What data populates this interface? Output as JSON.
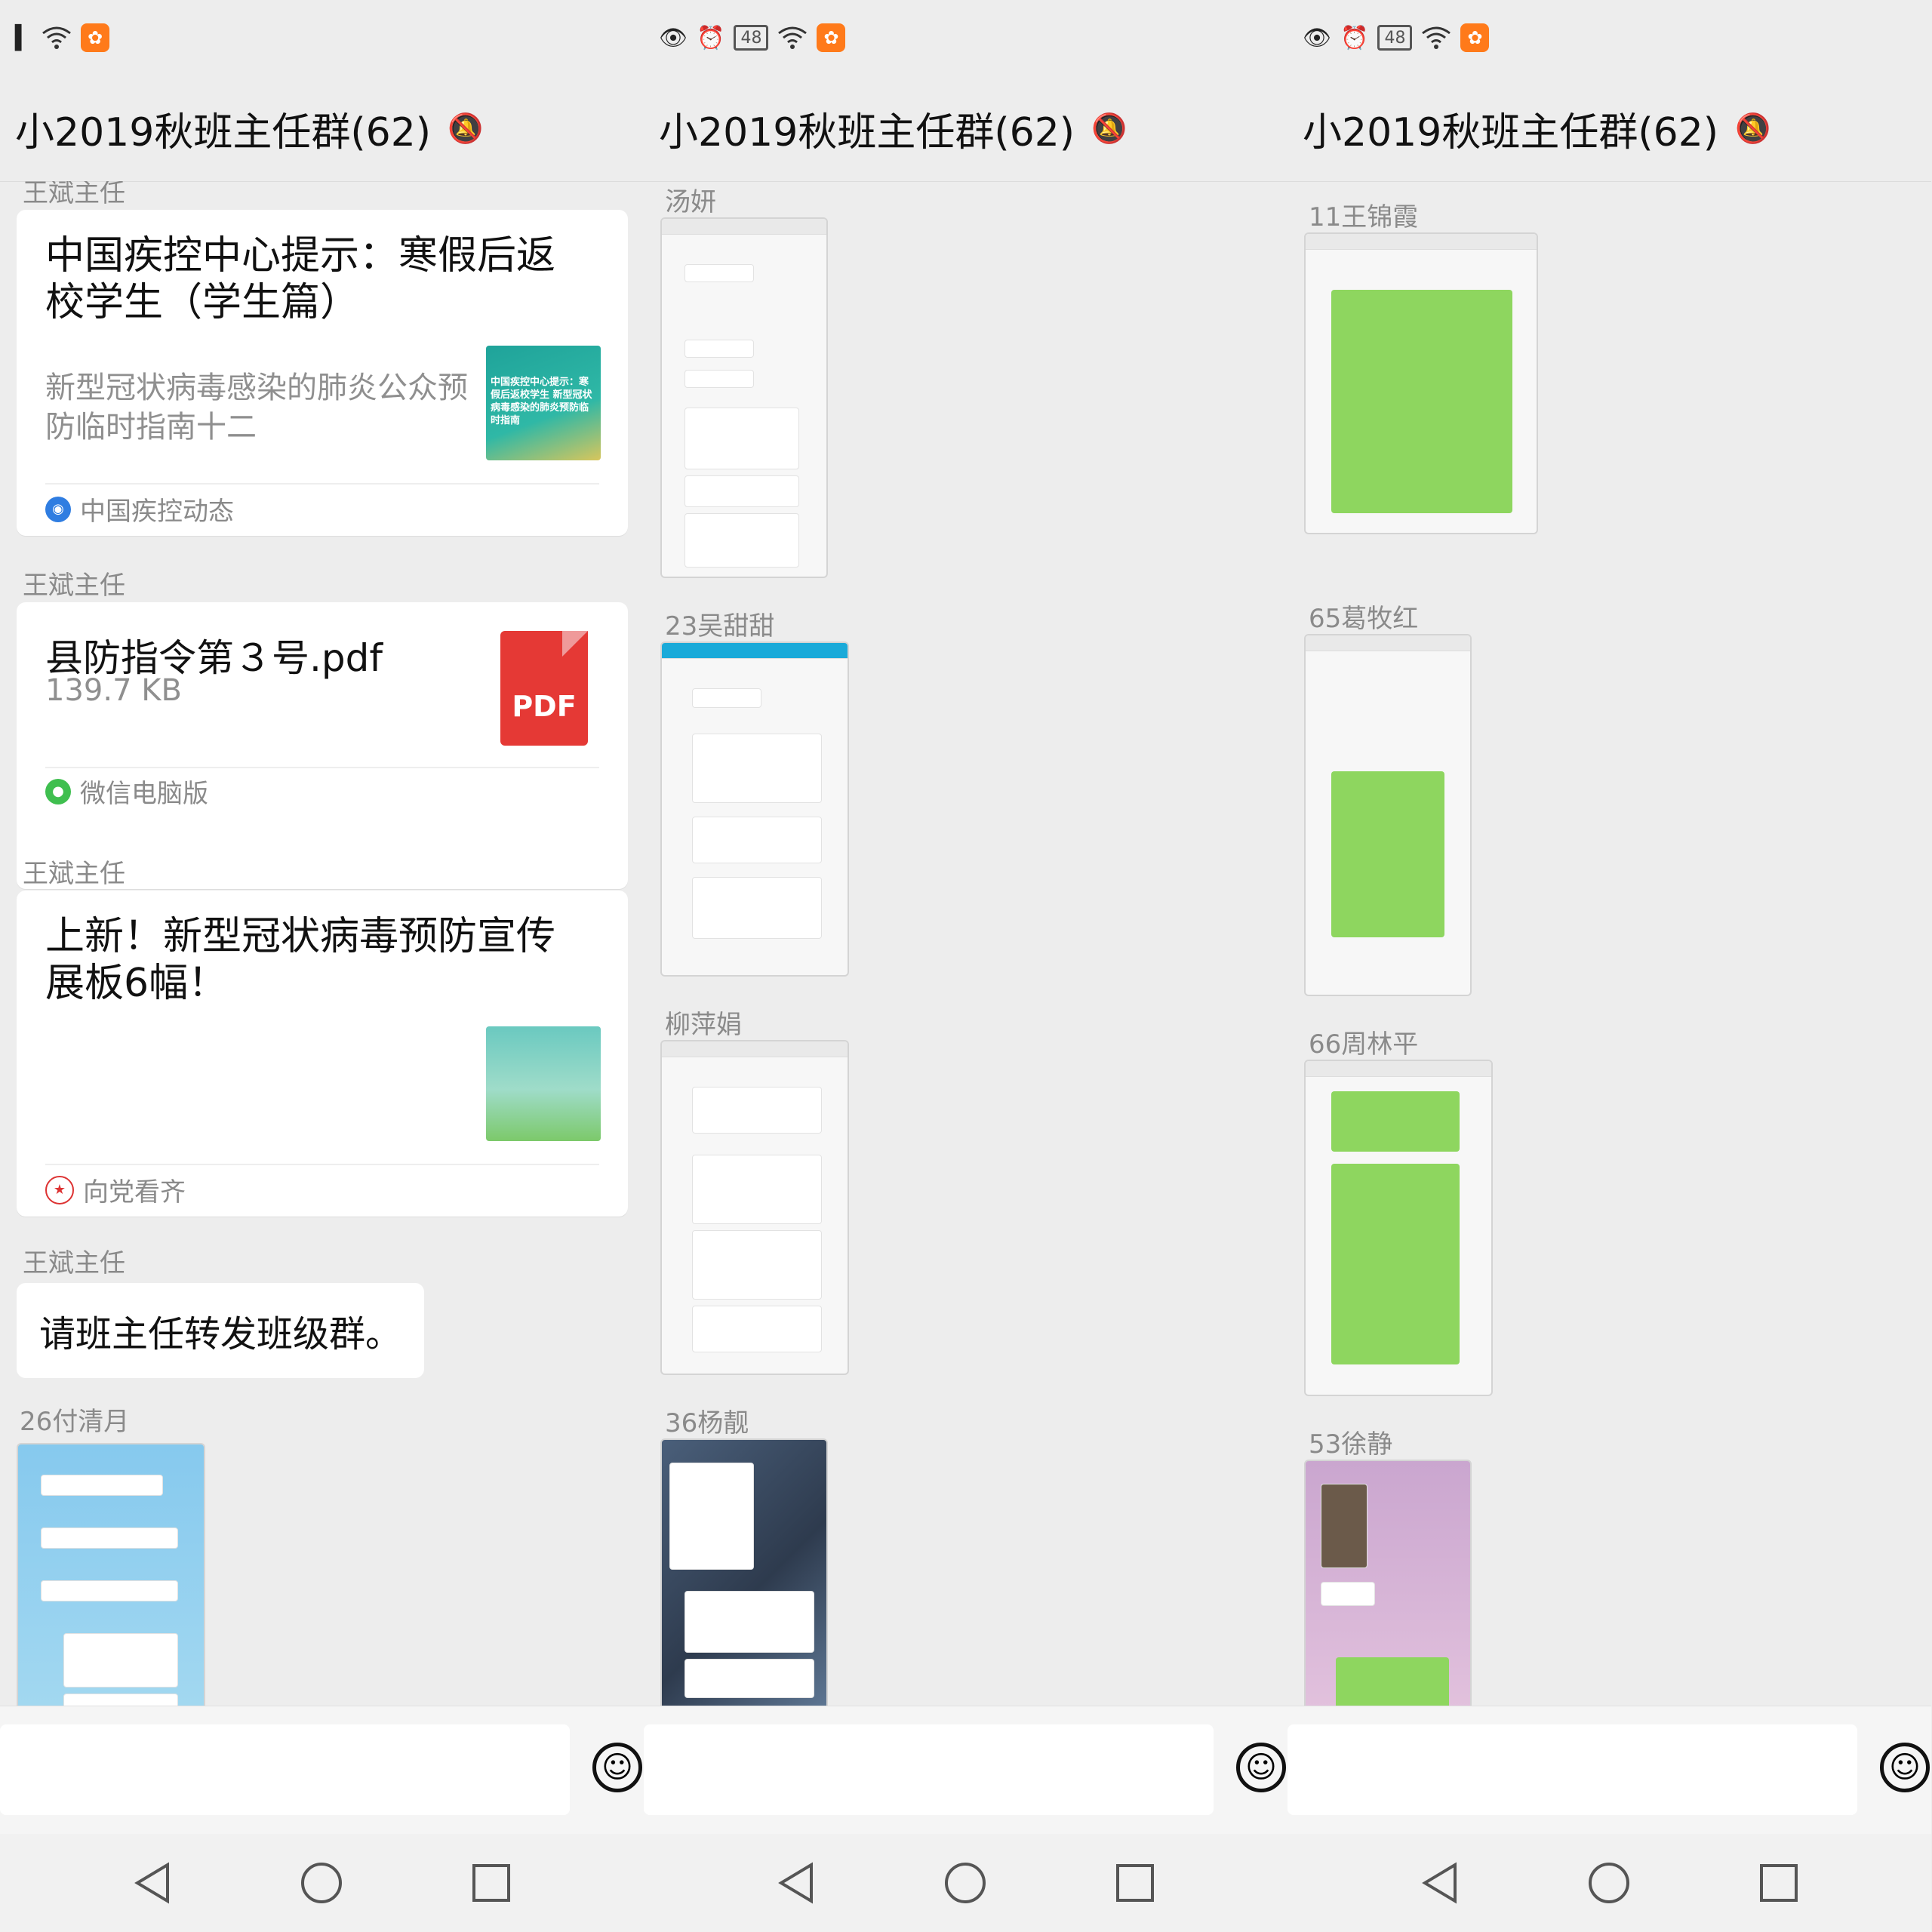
{
  "status_bar": {
    "battery": "48"
  },
  "group": {
    "title": "小2019秋班主任群(62)"
  },
  "panel1": {
    "messages": [
      {
        "sender": "王斌主任"
      },
      {
        "sender": "王斌主任",
        "title": "中国疾控中心提示：寒假后返校学生（学生篇）",
        "desc": "新型冠状病毒感染的肺炎公众预防临时指南十二",
        "thumb_text": "中国疾控中心提示：寒假后返校学生 新型冠状病毒感染的肺炎预防临时指南",
        "source": "中国疾控动态"
      },
      {
        "sender": "王斌主任",
        "file_name": "县防指令第３号.pdf",
        "file_size": "139.7 KB",
        "file_icon_text": "PDF",
        "source": "微信电脑版"
      },
      {
        "sender": "王斌主任",
        "title": "上新！新型冠状病毒预防宣传展板6幅！",
        "source": "向党看齐"
      },
      {
        "sender": "王斌主任",
        "text": "请班主任转发班级群。"
      },
      {
        "sender": "26付清月"
      }
    ]
  },
  "panel2": {
    "messages": [
      {
        "sender": "汤妍"
      },
      {
        "sender": "23吴甜甜"
      },
      {
        "sender": "柳萍娟"
      },
      {
        "sender": "36杨靓"
      }
    ]
  },
  "panel3": {
    "messages": [
      {
        "sender": "11王锦霞"
      },
      {
        "sender": "65葛牧红"
      },
      {
        "sender": "66周林平"
      },
      {
        "sender": "53徐静"
      }
    ]
  },
  "colors": {
    "background": "#ededed",
    "pdf": "#e53935",
    "wechat_green": "#8ed65f"
  },
  "icons": [
    "signal-icon",
    "wifi-icon",
    "uc-browser-icon",
    "eye-icon",
    "alarm-icon",
    "battery-icon",
    "mute-bell-icon",
    "emoji-icon",
    "back-nav-icon",
    "home-nav-icon",
    "recents-nav-icon"
  ]
}
